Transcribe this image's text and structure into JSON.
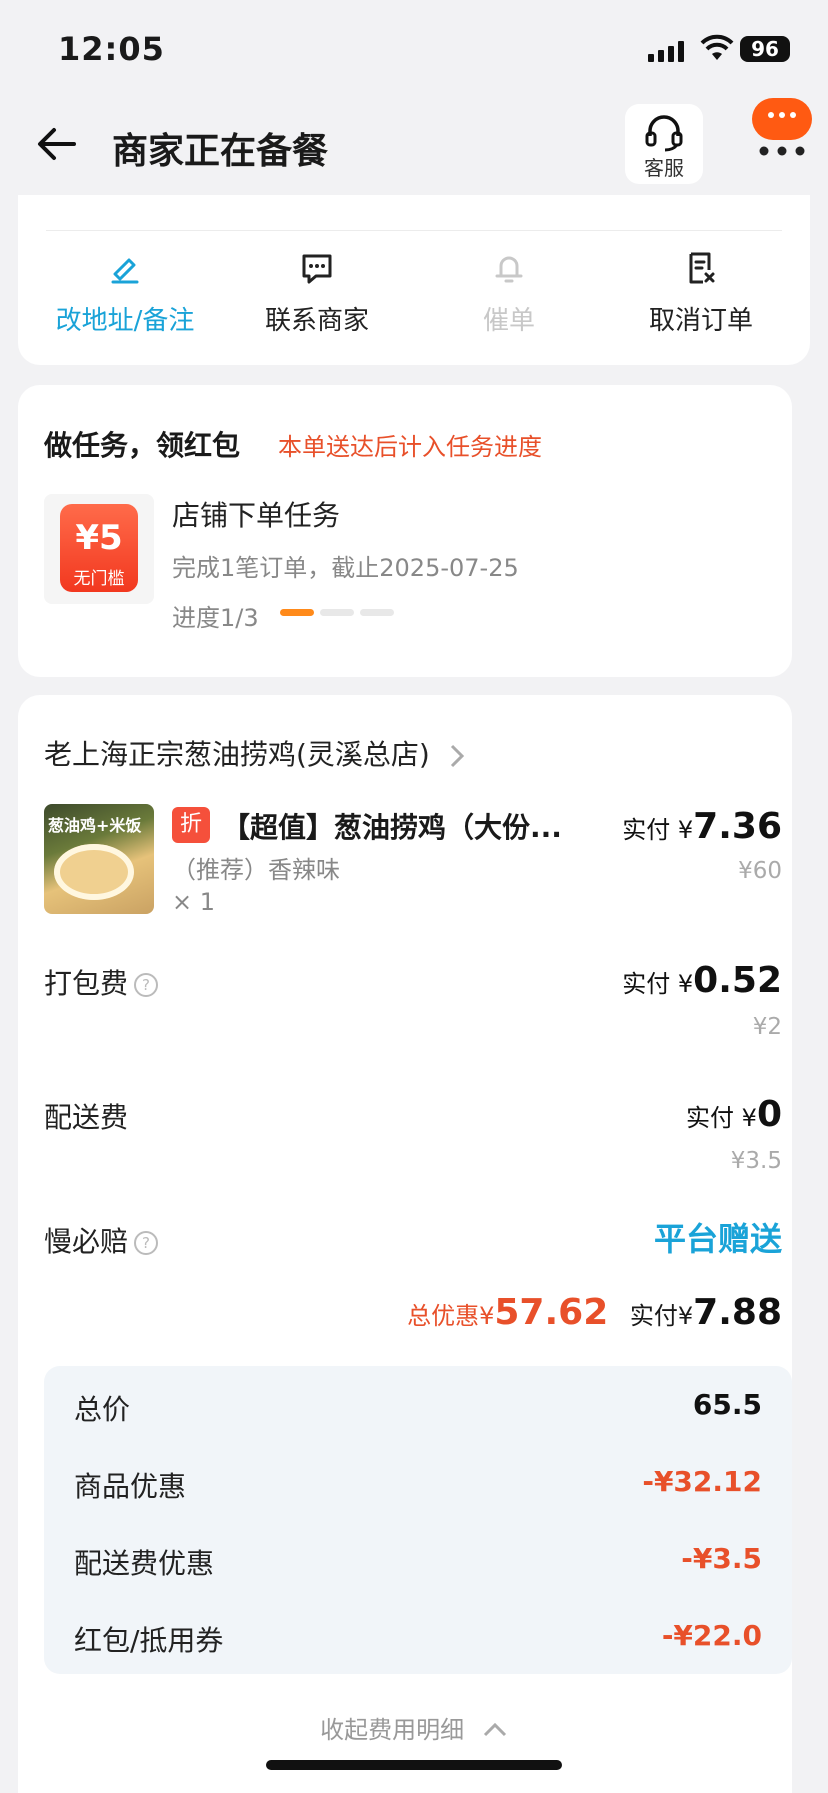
{
  "status_bar": {
    "time": "12:05",
    "battery": "96"
  },
  "header": {
    "title": "商家正在备餐",
    "service_label": "客服"
  },
  "actions": [
    {
      "label": "改地址/备注",
      "icon": "edit-icon",
      "color": "#1aa3d8"
    },
    {
      "label": "联系商家",
      "icon": "chat-icon",
      "color": "#222222"
    },
    {
      "label": "催单",
      "icon": "bell-icon",
      "color": "#c8c8c8"
    },
    {
      "label": "取消订单",
      "icon": "cancel-doc-icon",
      "color": "#222222"
    }
  ],
  "task": {
    "title": "做任务，领红包",
    "note": "本单送达后计入任务进度",
    "coupon_amount": "¥5",
    "coupon_tag": "无门槛",
    "name": "店铺下单任务",
    "desc": "完成1笔订单，截止2025-07-25",
    "progress_text": "进度1/3",
    "progress_fraction": 0.333
  },
  "order": {
    "store": "老上海正宗葱油捞鸡(灵溪总店)",
    "item": {
      "thumb_text": "葱油鸡+米饭",
      "badge": "折",
      "name": "【超值】葱油捞鸡（大份...",
      "spec": "（推荐）香辣味",
      "qty": "× 1",
      "paid_prefix": "实付 ¥",
      "paid": "7.36",
      "orig": "¥60"
    },
    "packing": {
      "label": "打包费",
      "paid_prefix": "实付 ¥",
      "paid": "0.52",
      "orig": "¥2"
    },
    "delivery": {
      "label": "配送费",
      "paid_prefix": "实付 ¥",
      "paid": "0",
      "orig": "¥3.5"
    },
    "late": {
      "label": "慢必赔",
      "value": "平台赠送"
    },
    "total": {
      "discount_label": "总优惠¥",
      "discount": "57.62",
      "paid_label": "实付¥",
      "paid": "7.88"
    },
    "breakdown": [
      {
        "label": "总价",
        "value": "65.5",
        "color": "#111111"
      },
      {
        "label": "商品优惠",
        "value": "-¥32.12",
        "color": "#e8502a"
      },
      {
        "label": "配送费优惠",
        "value": "-¥3.5",
        "color": "#e8502a"
      },
      {
        "label": "红包/抵用券",
        "value": "-¥22.0",
        "color": "#e8502a"
      }
    ],
    "collapse_label": "收起费用明细"
  }
}
